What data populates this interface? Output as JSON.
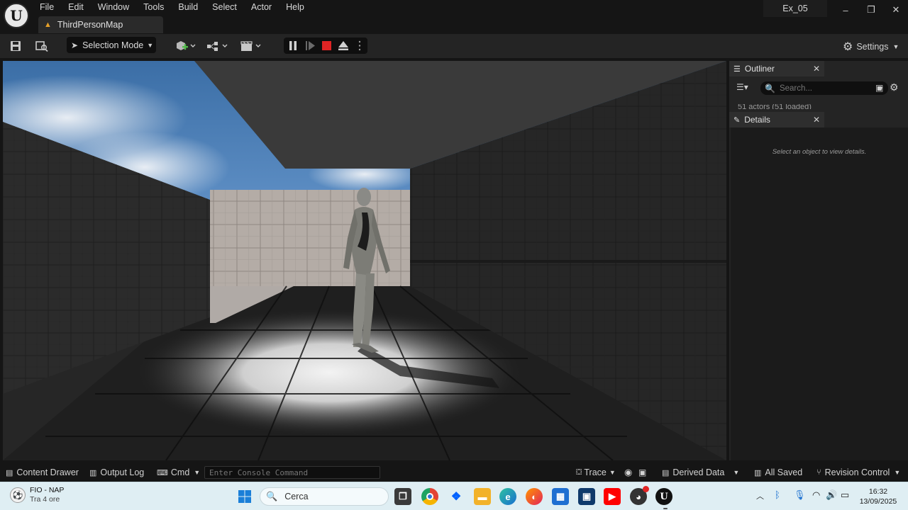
{
  "app": {
    "menu": [
      "File",
      "Edit",
      "Window",
      "Tools",
      "Build",
      "Select",
      "Actor",
      "Help"
    ],
    "map_tab": "ThirdPersonMap",
    "project_name": "Ex_05"
  },
  "toolbar": {
    "selection_mode": "Selection Mode",
    "settings": "Settings"
  },
  "outliner": {
    "title": "Outliner",
    "search_placeholder": "Search...",
    "actor_count": "51 actors (51 loaded)"
  },
  "details": {
    "title": "Details",
    "empty_message": "Select an object to view details."
  },
  "statusbar": {
    "content_drawer": "Content Drawer",
    "output_log": "Output Log",
    "cmd": "Cmd",
    "console_placeholder": "Enter Console Command",
    "trace": "Trace",
    "derived_data": "Derived Data",
    "all_saved": "All Saved",
    "revision_control": "Revision Control"
  },
  "taskbar": {
    "weather_title": "FIO - NAP",
    "weather_subtitle": "Tra 4 ore",
    "search_label": "Cerca",
    "time": "16:32",
    "date": "13/09/2025"
  },
  "colors": {
    "accent": "#e5a029",
    "stop_red": "#e02424",
    "taskbar_bg": "#dfeef3"
  }
}
